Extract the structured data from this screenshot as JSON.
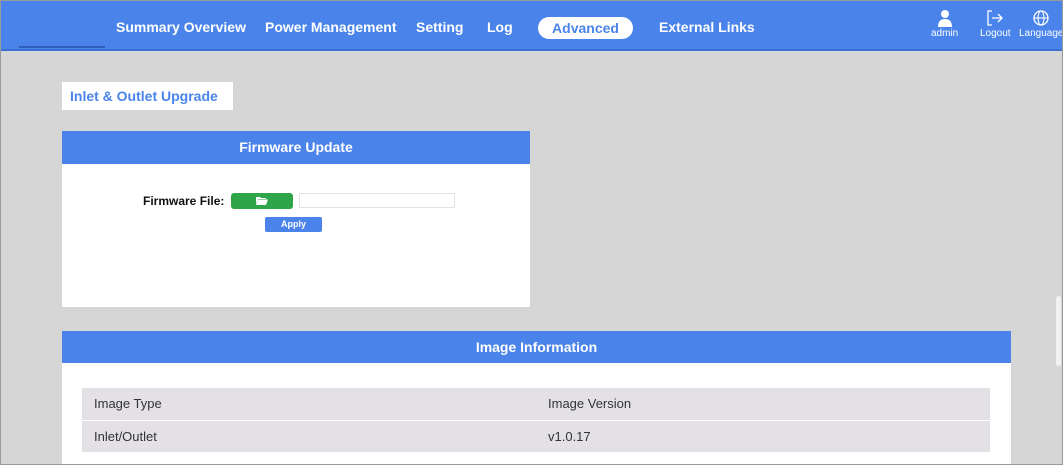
{
  "nav": {
    "items": [
      "Summary Overview",
      "Power Management",
      "Setting",
      "Log"
    ],
    "active": "Advanced",
    "external": "External Links",
    "user_label": "admin",
    "logout_label": "Logout",
    "language_label": "Language"
  },
  "page": {
    "heading": "Inlet & Outlet Upgrade"
  },
  "firmware": {
    "title": "Firmware Update",
    "file_label": "Firmware File:",
    "file_value": "",
    "apply_label": "Apply"
  },
  "image_info": {
    "title": "Image Information",
    "columns": [
      "Image Type",
      "Image Version"
    ],
    "rows": [
      [
        "Inlet/Outlet",
        "v1.0.17"
      ]
    ]
  },
  "colors": {
    "accent": "#4a84ea",
    "browse_button": "#2fa54a",
    "background": "#d6d6d6"
  }
}
